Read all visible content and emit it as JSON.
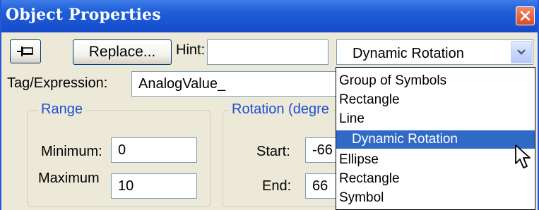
{
  "window": {
    "title": "Object Properties"
  },
  "toolbar": {
    "replace_label": "Replace...",
    "hint_label": "Hint:",
    "hint_value": "",
    "type_value": "Dynamic Rotation"
  },
  "tag": {
    "label": "Tag/Expression:",
    "value": "AnalogValue_"
  },
  "range": {
    "caption": "Range",
    "min_label": "Minimum:",
    "min_value": "0",
    "max_label": "Maximum",
    "max_value": "10"
  },
  "rotation": {
    "caption": "Rotation (degre",
    "start_label": "Start:",
    "start_value": "-66",
    "end_label": "End:",
    "end_value": "66"
  },
  "dropdown": {
    "items": [
      {
        "label": "Group of Symbols",
        "selected": false
      },
      {
        "label": "Rectangle",
        "selected": false
      },
      {
        "label": "Line",
        "selected": false
      },
      {
        "label": "Dynamic Rotation",
        "selected": true
      },
      {
        "label": "Ellipse",
        "selected": false
      },
      {
        "label": "Rectangle",
        "selected": false
      },
      {
        "label": "Symbol",
        "selected": false
      }
    ]
  },
  "icons": {
    "pin": "pin-icon",
    "close": "close-icon",
    "combo_arrow": "chevron-down-icon",
    "cursor": "mouse-pointer-icon"
  },
  "colors": {
    "title_bar": "#1f5fd8",
    "dialog_bg": "#ece9d8",
    "selection": "#316ac5",
    "group_caption": "#1c4fd0",
    "close_button": "#d94b23"
  }
}
